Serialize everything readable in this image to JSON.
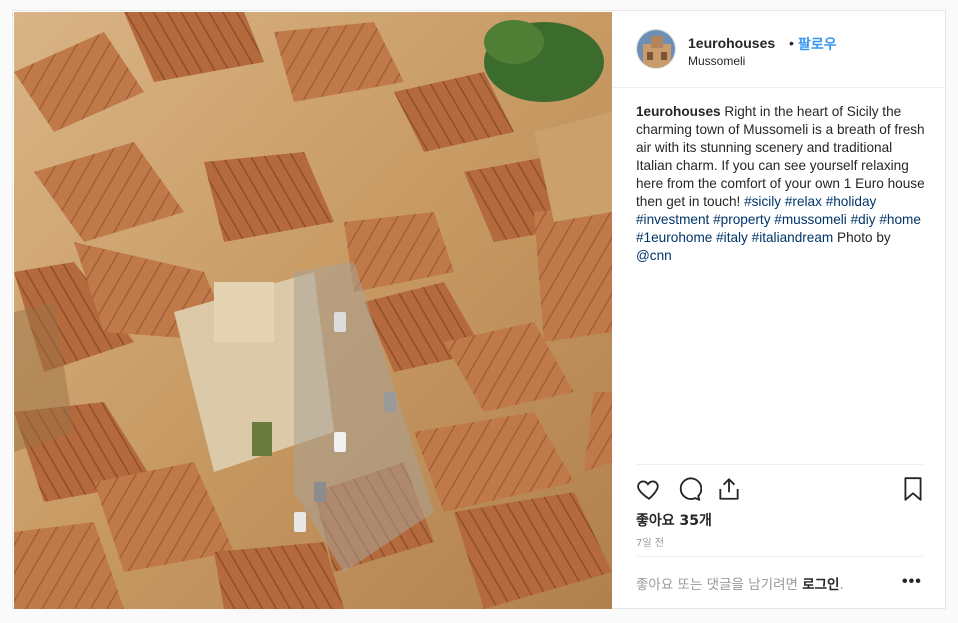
{
  "post": {
    "username": "1eurohouses",
    "separator": "•",
    "follow_label": "팔로우",
    "location": "Mussomeli",
    "caption": {
      "username": "1eurohouses",
      "text_1": " Right in the heart of Sicily the charming town of Mussomeli is a breath of fresh air with its stunning scenery and traditional Italian charm. If you can see yourself relaxing here from the comfort of your own 1 Euro house then get in touch! ",
      "hashtags": [
        "#sicily",
        "#relax",
        "#holiday",
        "#investment",
        "#property",
        "#mussomeli",
        "#diy",
        "#home",
        "#1eurohome",
        "#italy",
        "#italiandream"
      ],
      "text_2": " Photo by ",
      "mention": "@cnn"
    },
    "likes_label": "좋아요 35개",
    "time_ago": "7일 전",
    "login_prompt": "좋아요 또는 댓글을 남기려면 ",
    "login_link": "로그인",
    "login_suffix": ".",
    "more_label": "•••"
  },
  "icons": {
    "like": "heart-icon",
    "comment": "comment-icon",
    "share": "share-icon",
    "save": "bookmark-icon"
  },
  "colors": {
    "link_blue": "#3897f0",
    "hashtag": "#003569",
    "muted": "#999999",
    "text": "#262626",
    "border": "#efefef"
  }
}
